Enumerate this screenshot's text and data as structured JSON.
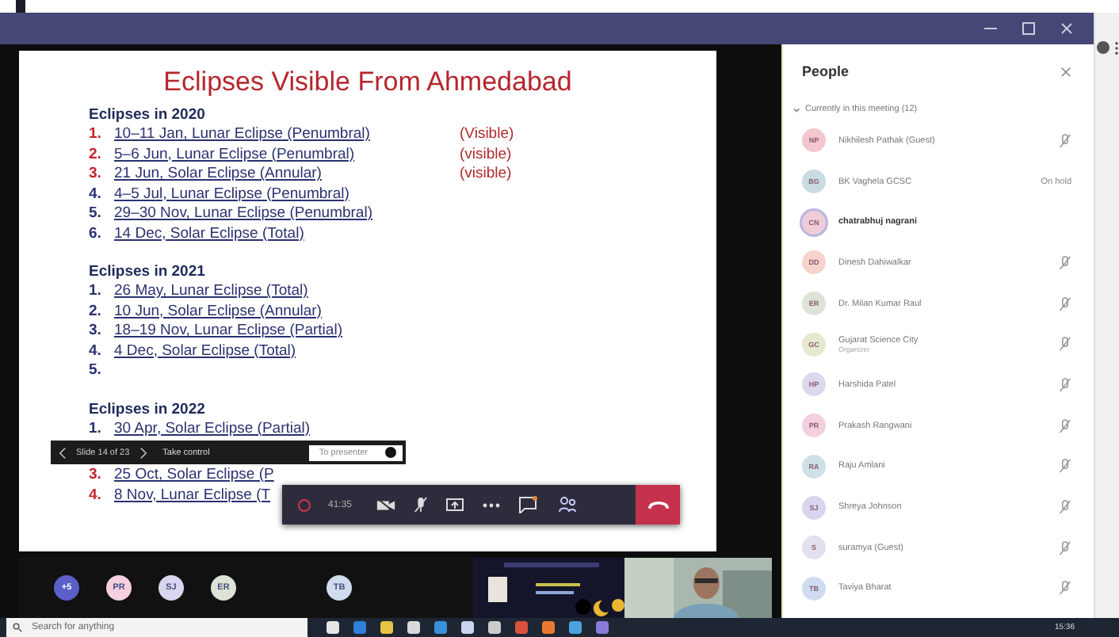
{
  "slide": {
    "title": "Eclipses Visible From Ahmedabad",
    "sections": [
      {
        "heading": "Eclipses in 2020",
        "items": [
          {
            "number": "1.",
            "text": "10–11 Jan, Lunar Eclipse (Penumbral)",
            "highlight": true,
            "note": "(Visible)"
          },
          {
            "number": "2.",
            "text": "5–6 Jun, Lunar Eclipse (Penumbral)",
            "highlight": true,
            "note": "(visible)"
          },
          {
            "number": "3.",
            "text": "21 Jun, Solar Eclipse (Annular)",
            "highlight": true,
            "note": "(visible)"
          },
          {
            "number": "4.",
            "text": "4–5 Jul, Lunar Eclipse (Penumbral)",
            "highlight": false
          },
          {
            "number": "5.",
            "text": "29–30 Nov, Lunar Eclipse (Penumbral)",
            "highlight": false
          },
          {
            "number": "6.",
            "text": "14 Dec, Solar Eclipse (Total)",
            "highlight": false
          }
        ]
      },
      {
        "heading": "Eclipses in 2021",
        "items": [
          {
            "number": "1.",
            "text": "26 May, Lunar Eclipse (Total)",
            "highlight": false
          },
          {
            "number": "2.",
            "text": "10 Jun, Solar Eclipse (Annular)",
            "highlight": false
          },
          {
            "number": "3.",
            "text": "18–19 Nov, Lunar Eclipse (Partial)",
            "highlight": false
          },
          {
            "number": "4.",
            "text": "4 Dec, Solar Eclipse (Total)",
            "highlight": false
          },
          {
            "number": "5.",
            "highlight": false
          }
        ]
      },
      {
        "heading": "Eclipses in 2022",
        "items": [
          {
            "number": "1.",
            "text": "30 Apr, Solar Eclipse (Partial)",
            "highlight": false
          },
          {
            "number": "3.",
            "text": "25 Oct, Solar Eclipse (P",
            "highlight": true
          },
          {
            "number": "4.",
            "text": "8 Nov, Lunar Eclipse (T",
            "highlight": true
          }
        ]
      }
    ]
  },
  "presenter_bar": {
    "slide_counter": "Slide 14 of 23",
    "take_control": "Take control",
    "to_presenter": "To presenter"
  },
  "call_bar": {
    "recording": true,
    "duration": "41:35"
  },
  "people": {
    "title": "People",
    "section": "Currently in this meeting (12)",
    "expanded": true,
    "members": [
      {
        "initials": "NP",
        "name": "Nikhilesh Pathak (Guest)",
        "color": "#f3c6d0",
        "muted": true,
        "bold": false
      },
      {
        "initials": "BG",
        "name": "BK Vaghela GCSC",
        "color": "#c9dbe3",
        "muted": false,
        "status": "On hold",
        "bold": false
      },
      {
        "initials": "CN",
        "name": "chatrabhuj nagrani",
        "color": "#f0ccd8",
        "muted": false,
        "bold": true
      },
      {
        "initials": "DD",
        "name": "Dinesh Dahiwalkar",
        "color": "#f7d3cc",
        "muted": true,
        "bold": false
      },
      {
        "initials": "ER",
        "name": "Dr. Milan Kumar Raul",
        "color": "#dde3d6",
        "muted": true,
        "bold": false
      },
      {
        "initials": "GC",
        "name": "Gujarat Science City",
        "subtitle": "Organizer",
        "color": "#e6e8cf",
        "muted": true,
        "bold": false
      },
      {
        "initials": "HP",
        "name": "Harshida Patel",
        "color": "#dcd8ee",
        "muted": true,
        "bold": false
      },
      {
        "initials": "PR",
        "name": "Prakash Rangwani",
        "color": "#f3cfe0",
        "muted": true,
        "bold": false
      },
      {
        "initials": "RA",
        "name": "Raju Amlani",
        "color": "#cfe0e8",
        "muted": true,
        "bold": false
      },
      {
        "initials": "SJ",
        "name": "Shreya Johnson",
        "color": "#d8d6ee",
        "muted": true,
        "bold": false
      },
      {
        "initials": "S",
        "name": "suramya (Guest)",
        "color": "#e2e0ee",
        "muted": true,
        "bold": false
      },
      {
        "initials": "TB",
        "name": "Taviya Bharat",
        "color": "#cfdcf0",
        "muted": true,
        "bold": false
      }
    ]
  },
  "participants": [
    {
      "initials": "+5",
      "color": "#5b5fc7"
    },
    {
      "initials": "PR",
      "color": "#f3cfe0"
    },
    {
      "initials": "SJ",
      "color": "#d8d6ee"
    },
    {
      "initials": "ER",
      "color": "#dde3d6"
    },
    {
      "initials": "TB",
      "color": "#cfdcf0"
    }
  ],
  "taskbar": {
    "search_placeholder": "Search for anything",
    "time": "15:36"
  }
}
